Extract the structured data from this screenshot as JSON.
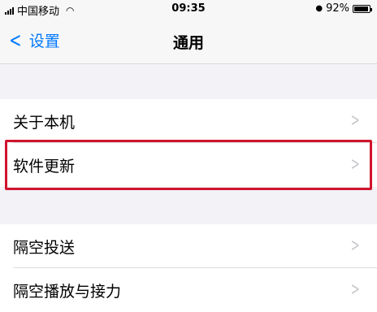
{
  "status_bar": {
    "carrier": "中国移动",
    "time": "09:35",
    "battery": "92%",
    "battery_level": 0.92
  },
  "nav": {
    "back_label": "设置",
    "title": "通用"
  },
  "groups": [
    {
      "items": [
        {
          "label": "关于本机"
        },
        {
          "label": "软件更新"
        }
      ]
    },
    {
      "items": [
        {
          "label": "隔空投送"
        },
        {
          "label": "隔空播放与接力"
        }
      ]
    }
  ],
  "highlight_color": "#d0142c"
}
